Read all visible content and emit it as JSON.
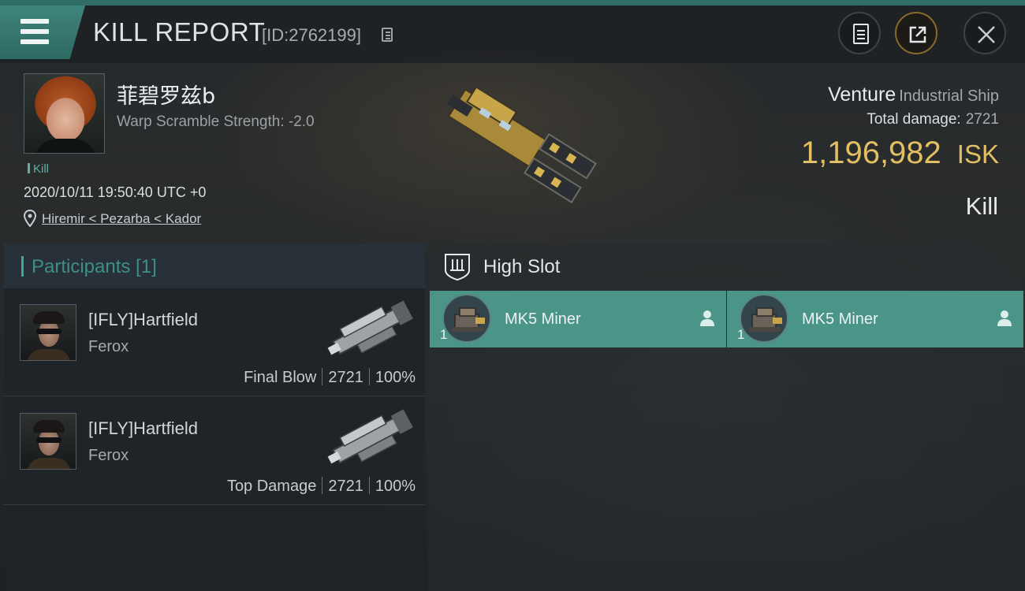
{
  "header": {
    "title": "KILL REPORT",
    "report_id": "[ID:2762199]"
  },
  "victim": {
    "name": "菲碧罗兹b",
    "warp_scramble": "Warp Scramble Strength: -2.0",
    "tag": "Kill",
    "timestamp": "2020/10/11 19:50:40 UTC +0",
    "location": "Hiremir < Pezarba < Kador",
    "ship_name": "Venture",
    "ship_class": "Industrial Ship",
    "total_damage_label": "Total damage:",
    "total_damage": "2721",
    "isk_value": "1,196,982",
    "isk_unit": "ISK",
    "result": "Kill"
  },
  "participants": {
    "title": "Participants [1]",
    "rows": [
      {
        "name": "[IFLY]Hartfield",
        "ship": "Ferox",
        "role": "Final Blow",
        "damage": "2721",
        "percent": "100%"
      },
      {
        "name": "[IFLY]Hartfield",
        "ship": "Ferox",
        "role": "Top Damage",
        "damage": "2721",
        "percent": "100%"
      }
    ]
  },
  "high_slot": {
    "title": "High Slot",
    "items": [
      {
        "name": "MK5 Miner",
        "qty": "1"
      },
      {
        "name": "MK5 Miner",
        "qty": "1"
      }
    ]
  },
  "colors": {
    "accent_teal": "#3ea89a",
    "isk_gold": "#e3bf63",
    "slot_bg": "#4a9488"
  }
}
